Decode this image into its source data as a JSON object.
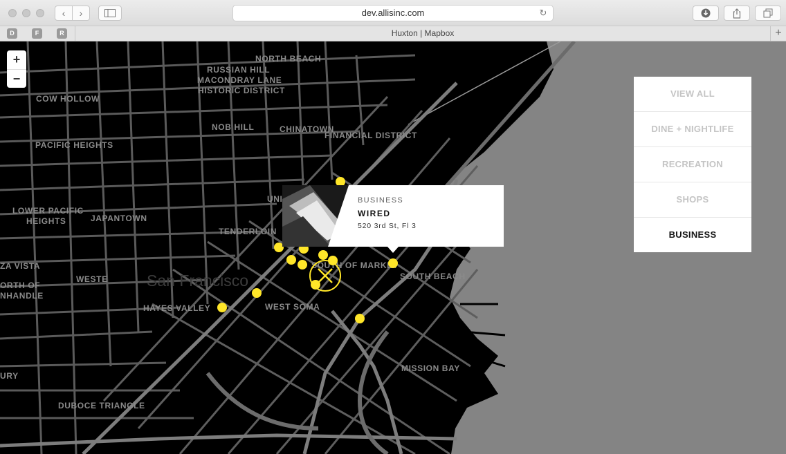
{
  "browser": {
    "url": "dev.allisinc.com",
    "tab_title": "Huxton | Mapbox",
    "favorites": [
      "D",
      "F",
      "R"
    ]
  },
  "map": {
    "zoom_in": "+",
    "zoom_out": "−",
    "city_label": "San Francisco",
    "neighborhoods": {
      "north_beach": "NORTH BEACH",
      "russian_hill": "RUSSIAN HILL",
      "macondray_lane": "MACONDRAY LANE",
      "historic_district": "HISTORIC DISTRICT",
      "cow_hollow": "COW HOLLOW",
      "nob_hill": "NOB HILL",
      "chinatown": "CHINATOWN",
      "financial_district": "FINANCIAL DISTRICT",
      "pacific_heights": "PACIFIC HEIGHTS",
      "lower_pacific": "LOWER PACIFIC",
      "heights": "HEIGHTS",
      "japantown": "JAPANTOWN",
      "union": "UNI",
      "tenderloin": "TENDERLOIN",
      "south_of_market": "SOUTH OF MARKET",
      "south_beach": "SOUTH BEACH",
      "za_vista": "ZA VISTA",
      "orth_of": "ORTH OF",
      "nhandle": "NHANDLE",
      "weste": "WESTE",
      "hayes_valley": "HAYES VALLEY",
      "west_soma": "WEST SOMA",
      "mission_bay": "MISSION BAY",
      "ury": "URY",
      "duboce_triangle": "DUBOCE TRIANGLE"
    },
    "accent_color": "#ffe629"
  },
  "popup": {
    "category": "BUSINESS",
    "name": "WIRED",
    "address": "520 3rd St, Fl 3"
  },
  "menu": {
    "items": [
      "VIEW ALL",
      "DINE + NIGHTLIFE",
      "RECREATION",
      "SHOPS",
      "BUSINESS"
    ],
    "active": "BUSINESS"
  }
}
